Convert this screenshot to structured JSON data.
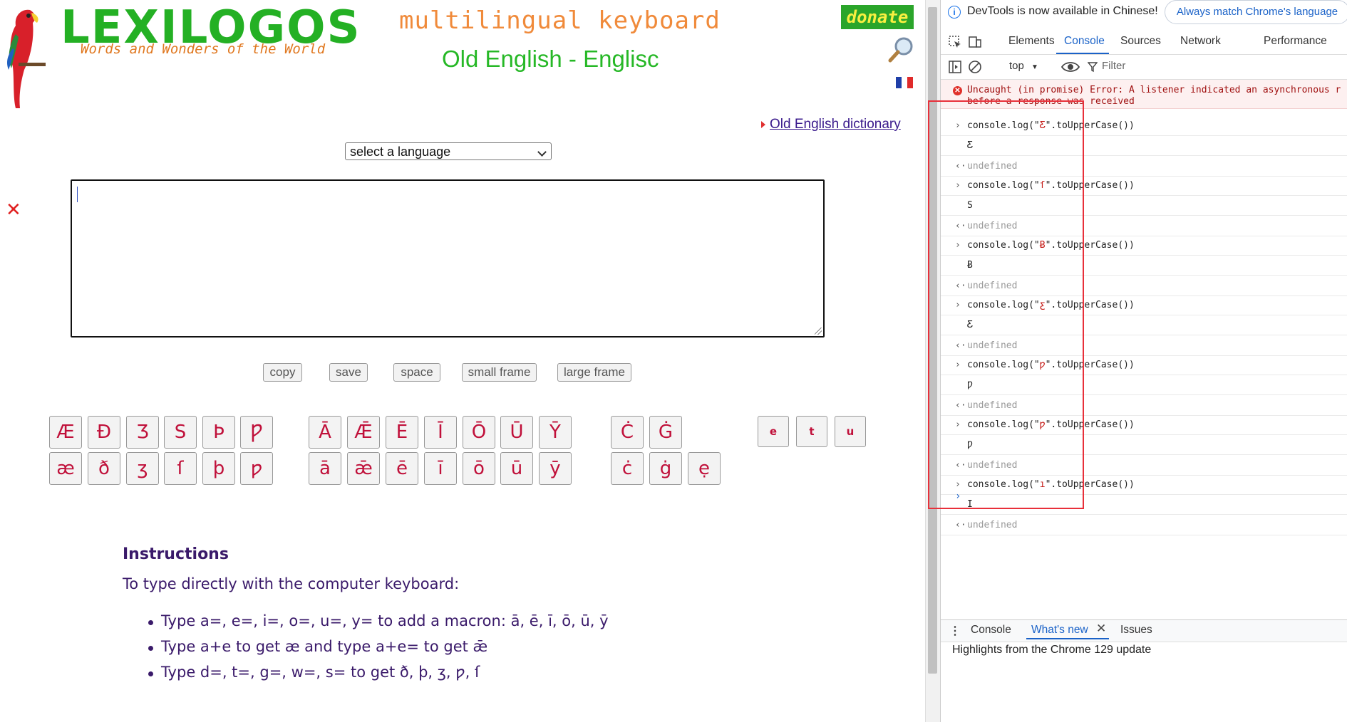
{
  "page": {
    "logo_text": "LEXILOGOS",
    "logo_tagline": "Words and Wonders of the World",
    "keyboard_title": "multilingual keyboard",
    "language_title": "Old English - Englisc",
    "donate_label": "donate",
    "dictionary_link": "Old English dictionary",
    "language_select": "select a language",
    "textarea_value": "",
    "buttons": {
      "copy": "copy",
      "save": "save",
      "space": "space",
      "small_frame": "small frame",
      "large_frame": "large frame"
    },
    "keys_row1_group1": [
      "Æ",
      "Đ",
      "Ʒ",
      "S",
      "Þ",
      "Ƿ"
    ],
    "keys_row2_group1": [
      "æ",
      "ð",
      "ʒ",
      "ſ",
      "þ",
      "ƿ"
    ],
    "keys_row1_group2": [
      "Ā",
      "Ǣ",
      "Ē",
      "Ī",
      "Ō",
      "Ū",
      "Ȳ"
    ],
    "keys_row2_group2": [
      "ā",
      "ǣ",
      "ē",
      "ī",
      "ō",
      "ū",
      "ȳ"
    ],
    "keys_row1_group3": [
      "Ċ",
      "Ġ"
    ],
    "keys_row2_group3": [
      "ċ",
      "ġ",
      "ẹ"
    ],
    "keys_small": [
      "e",
      "t",
      "u"
    ],
    "instructions_heading": "Instructions",
    "instructions_intro": "To type directly with the computer keyboard:",
    "instructions_items": [
      "Type a=, e=, i=, o=, u=, y= to add a macron: ā, ē, ī, ō, ū, ȳ",
      "Type a+e to get æ and type a+e= to get ǣ",
      "Type d=, t=, g=, w=, s= to get ð, þ, ʒ, ƿ, ſ"
    ]
  },
  "devtools": {
    "info_text": "DevTools is now available in Chinese!",
    "match_button": "Always match Chrome's language",
    "tabs": [
      "Elements",
      "Console",
      "Sources",
      "Network",
      "Performance"
    ],
    "active_tab": "Console",
    "context": "top",
    "filter_placeholder": "Filter",
    "error_line1": "Uncaught (in promise) Error: A listener indicated an asynchronous r",
    "error_line2": "before a response was received",
    "entries": [
      {
        "pre": "console.log(\"",
        "str": "Ƹ",
        "post": "\".toUpperCase())",
        "out": "Ƹ"
      },
      {
        "pre": "console.log(\"",
        "str": "ſ",
        "post": "\".toUpperCase())",
        "out": "S"
      },
      {
        "pre": "console.log(\"",
        "str": "Ƀ",
        "post": "\".toUpperCase())",
        "out": "Ƀ"
      },
      {
        "pre": "console.log(\"",
        "str": "ƹ",
        "post": "\".toUpperCase())",
        "out": "Ƹ"
      },
      {
        "pre": "console.log(\"",
        "str": "ƿ",
        "post": "\".toUpperCase())",
        "out": "Ƿ"
      },
      {
        "pre": "console.log(\"",
        "str": "ƿ",
        "post": "\".toUpperCase())",
        "out": "Ƿ"
      },
      {
        "pre": "console.log(\"",
        "str": "ı",
        "post": "\".toUpperCase())",
        "out": "I"
      }
    ],
    "undefined_label": "undefined",
    "drawer_tabs": [
      "Console",
      "What's new",
      "Issues"
    ],
    "drawer_active": "What's new",
    "drawer_text": "Highlights from the Chrome 129 update"
  }
}
